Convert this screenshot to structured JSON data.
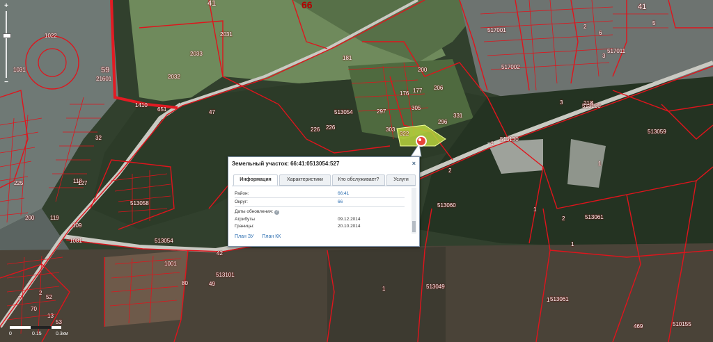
{
  "map": {
    "district_labels": [
      {
        "text": "41",
        "cls": "mid"
      },
      {
        "text": "66",
        "cls": "big"
      },
      {
        "text": "59",
        "cls": "mid"
      },
      {
        "text": "41",
        "cls": "mid"
      }
    ],
    "quarter_labels": [
      "513054",
      "513130",
      "513120",
      "513059",
      "513058",
      "513060",
      "513061",
      "513054",
      "513101",
      "513049",
      "513061",
      "510155",
      "517011",
      "517002",
      "517001",
      "21601"
    ],
    "parcel_labels": [
      "2031",
      "2033",
      "2032",
      "181",
      "1410",
      "651",
      "47",
      "297",
      "296",
      "226",
      "226",
      "176",
      "177",
      "322",
      "303",
      "331",
      "305",
      "206",
      "200",
      "2",
      "1",
      "2",
      "1",
      "1",
      "1",
      "1",
      "469",
      "1081",
      "1001",
      "49",
      "80",
      "42",
      "4",
      "6",
      "3",
      "2",
      "5",
      "1031",
      "1022",
      "32",
      "118",
      "109",
      "127",
      "119",
      "200",
      "225",
      "218",
      "4",
      "3",
      "2",
      "7",
      "70",
      "13",
      "52",
      "53",
      "25"
    ],
    "colors": {
      "boundary": "#e0141c",
      "road": "#d7d7d2",
      "selected": "#b7d33c"
    }
  },
  "zoom": {
    "plus": "+",
    "minus": "−",
    "levels": [
      "18",
      "16",
      "14",
      "12",
      "10",
      "8",
      "6",
      "4"
    ]
  },
  "scale": {
    "labels": [
      "0",
      "0.15",
      "0.3км"
    ]
  },
  "popup": {
    "title": "Земельный участок: 66:41:0513054:527",
    "close": "×",
    "tabs": [
      "Информация",
      "Характеристики",
      "Кто обслуживает?",
      "Услуги"
    ],
    "active_tab": "Информация",
    "rows": [
      {
        "label": "Район:",
        "value": "66:41",
        "link": true
      },
      {
        "label": "Округ:",
        "value": "66",
        "link": true
      }
    ],
    "update_section": "Даты обновления:",
    "updates": [
      {
        "label": "Атрибуты",
        "value": "09.12.2014"
      },
      {
        "label": "Границы:",
        "value": "20.10.2014"
      }
    ],
    "links": [
      "План ЗУ",
      "План КК"
    ]
  }
}
